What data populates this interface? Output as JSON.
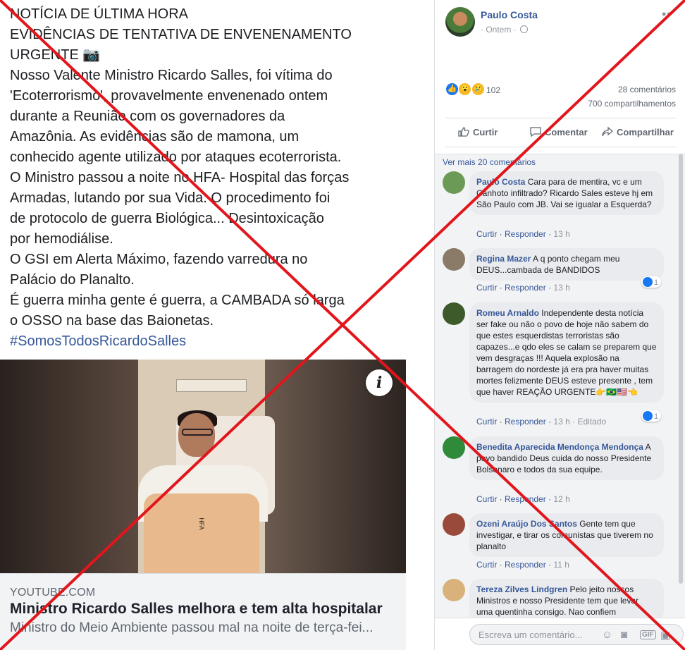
{
  "post": {
    "text_lines": [
      "NOTÍCIA DE ÚLTIMA HORA",
      "EVIDÊNCIAS DE TENTATIVA DE ENVENENAMENTO",
      "URGENTE 📷",
      "Nosso Valente Ministro Ricardo Salles, foi vítima do",
      "'Ecoterrorismo',  provavelmente  envenenado ontem",
      "durante  a Reunião  com os  governadores da",
      "Amazônia. As evidências  são de mamona,  um",
      "conhecido agente utilizado por ataques ecoterrorista.",
      "O Ministro passou a noite no HFA- Hospital das forças",
      "Armadas,   lutando por sua Vida. O procedimento  foi",
      "de protocolo de guerra  Biológica... Desintoxicação",
      "por hemodiálise.",
      "O GSI em Alerta Máximo,  fazendo varredura  no",
      "Palácio do Planalto.",
      "É  guerra minha gente  é  guerra, a CAMBADA  só  larga",
      "o OSSO na base das  Baionetas."
    ],
    "hashtag": "#SomosTodosRicardoSalles",
    "photo_label": "HFA",
    "info_icon": "i"
  },
  "link_preview": {
    "domain": "YOUTUBE.COM",
    "title": "Ministro Ricardo Salles melhora e tem alta hospitalar",
    "description": "Ministro do Meio Ambiente passou mal na noite de terça-fei..."
  },
  "header": {
    "author": "Paulo Costa",
    "meta": "· Ontem ·",
    "more": "••"
  },
  "stats": {
    "reaction_count": "102",
    "comments": "28 comentários",
    "shares": "700 compartilhamentos",
    "reaction_icons": [
      "like-icon",
      "wow-icon",
      "sad-icon"
    ]
  },
  "actions": {
    "like": "Curtir",
    "comment": "Comentar",
    "share": "Compartilhar"
  },
  "comments_section": {
    "see_more": "Ver mais 20 comentários",
    "items": [
      {
        "name": "Paulo Costa",
        "text": "Cara para de mentira, vc e um Canhoto infiltrado? Ricardo Sales esteve hj em São Paulo com JB. Vai se igualar a Esquerda?",
        "like": "Curtir",
        "reply": "Responder",
        "time": "13 h",
        "edited": "",
        "reactions": "",
        "avatar_color": "#6a9a55"
      },
      {
        "name": "Regina Mazer",
        "text": "A q ponto chegam meu DEUS...cambada de BANDIDOS",
        "like": "Curtir",
        "reply": "Responder",
        "time": "13 h",
        "edited": "",
        "reactions": "1",
        "avatar_color": "#8a7a68"
      },
      {
        "name": "Romeu Arnaldo",
        "text": "Independente desta notícia ser fake ou não o povo de hoje não sabem do que estes esquerdistas terroristas são capazes...e qdo eles se calam se preparem que vem desgraças !!! Aquela explosão na barragem do nordeste já era pra haver muitas mortes felizmente DEUS esteve presente , tem que haver REAÇÃO URGENTE👉🇧🇷🇺🇸👈",
        "like": "Curtir",
        "reply": "Responder",
        "time": "13 h",
        "edited": "· Editado",
        "reactions": "1",
        "avatar_color": "#3d5a2a"
      },
      {
        "name": "Benedita Aparecida Mendonça Mendonça",
        "text": "A povo bandido Deus cuida do nosso Presidente Bolsonaro e todos da sua equipe.",
        "like": "Curtir",
        "reply": "Responder",
        "time": "12 h",
        "edited": "",
        "reactions": "",
        "avatar_color": "#2f8a3a"
      },
      {
        "name": "Ozeni Araújo Dos Santos",
        "text": "Gente tem que investigar, e tirar os comunistas que tiverem no planalto",
        "like": "Curtir",
        "reply": "Responder",
        "time": "11 h",
        "edited": "",
        "reactions": "",
        "avatar_color": "#9a4a3a"
      },
      {
        "name": "Tereza Zilves Lindgren",
        "text": "Pelo jeito nossos Ministros e nosso Presidente tem que levar uma quentinha consigo. Nao confiem",
        "like": "",
        "reply": "",
        "time": "",
        "edited": "",
        "reactions": "",
        "avatar_color": "#d8b27a"
      }
    ]
  },
  "comment_input": {
    "placeholder": "Escreva um comentário..."
  },
  "colors": {
    "link_blue": "#365899",
    "overlay_red": "#e3151c",
    "bubble_bg": "#e9ebee"
  }
}
